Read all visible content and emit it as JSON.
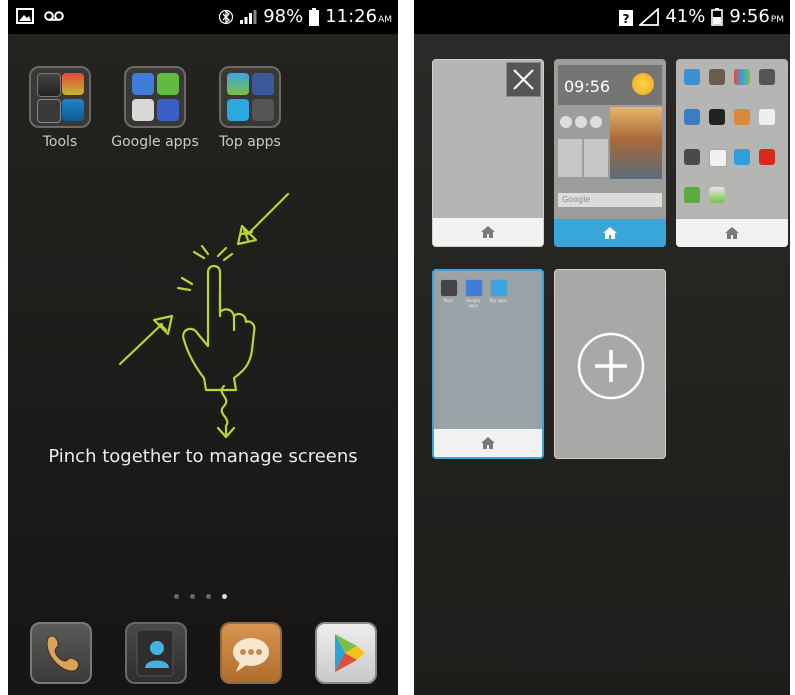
{
  "left_screen": {
    "status": {
      "battery": "98%",
      "time": "11:26",
      "ampm": "AM"
    },
    "folders": [
      {
        "label": "Tools"
      },
      {
        "label": "Google apps"
      },
      {
        "label": "Top apps"
      }
    ],
    "instruction": "Pinch together to manage screens",
    "page_indicator": {
      "count": 4,
      "active": 4
    },
    "dock": [
      "phone-icon",
      "contacts-icon",
      "messaging-icon",
      "play-store-icon"
    ]
  },
  "right_screen": {
    "status": {
      "notification": "?",
      "battery": "41%",
      "time": "9:56",
      "ampm": "PM"
    },
    "preview_clock": "09:56",
    "preview_search": "Google",
    "mini_folder_labels": [
      "Tools",
      "Google apps",
      "Top apps"
    ],
    "screens": [
      {
        "state": "empty",
        "deletable": true
      },
      {
        "state": "home",
        "default": true
      },
      {
        "state": "apps"
      },
      {
        "state": "folders",
        "selected": true
      },
      {
        "state": "add"
      }
    ]
  },
  "colors": {
    "accent": "#38a6d8",
    "gesture": "#b8d535",
    "thumb": "#b5b5b3",
    "foot": "#f2f2f2"
  }
}
